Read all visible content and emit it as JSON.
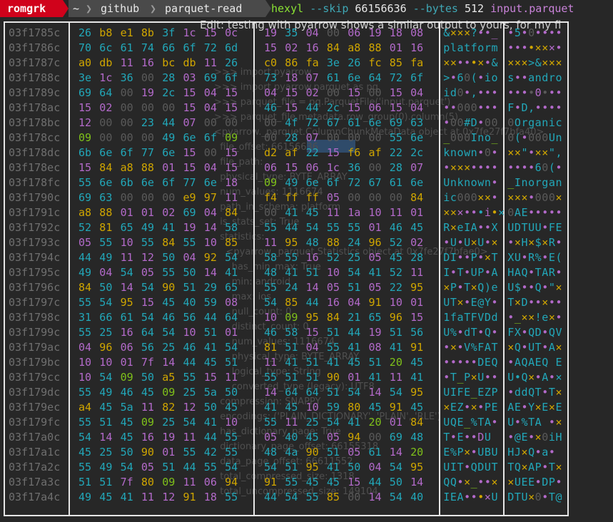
{
  "prompt": {
    "user": "romgrk",
    "path": [
      "~",
      "github",
      "parquet-read"
    ],
    "separator": "❯",
    "command": {
      "program": "hexyl",
      "flag1": "--skip",
      "skip_value": "66156636",
      "flag2": "--bytes",
      "bytes_value": "512",
      "file": "input.parquet"
    }
  },
  "colors": {
    "user_bg": "#d0021b",
    "null": "#5a5a5a",
    "printable": "#22a7b9",
    "whitespace": "#7fc11a",
    "ascii_other": "#d0a600",
    "non_ascii": "#b36aca"
  },
  "background_text": {
    "edit_line": "Edit: testing with pyarrow shows a similar output to yours, for my fi",
    "lines": [
      ">>> import pyarrow",
      ">>> import pyarrow.parquet as pq",
      ">>> parquet_file = pq.ParquetFile('input.parquet')",
      ">>> parquet_file.metadata.row_group(0).column(5)",
      "<pyarrow._parquet.ColumnChunkMetaData object at 0x7fe27f7bfa40>",
      "  file_offset: 66156636",
      "  file_path:",
      "  physical_type: BYTE_ARRAY",
      "  num_values: 1116674",
      "  path_in_schema: platform",
      "  is_stats_set: True",
      "  statistics:",
      "    <pyarrow._parquet.Statistics object at 0x7fe27f7bfae0>",
      "      has_min_max: True",
      "      min: android",
      "      max: ios",
      "      null_count: 0",
      "      distinct_count: 0",
      "      num_values: 1116674",
      "      physical_type: BYTE_ARRAY",
      "      logical_type: String",
      "      converted_type (legacy): UTF8",
      "  compression: SNAPPY",
      "  encodings: ('PLAIN_DICTIONARY', 'PLAIN', 'RLE')",
      "  has_dictionary_page: True",
      "  dictionary_page_offset: 66155318",
      "  data_page_offset: 66611552",
      "  total_compressed_size: 1318",
      "  total_uncompressed_size: 149104"
    ]
  },
  "hexdump": {
    "rows": [
      {
        "addr": "03f1785c",
        "hex1": [
          "26",
          "b8",
          "e1",
          "8b",
          "3f",
          "1c",
          "15",
          "0c"
        ],
        "hex2": [
          "19",
          "35",
          "04",
          "00",
          "06",
          "19",
          "18",
          "08"
        ],
        "ascii1": "&×××?••_",
        "ascii2": "•5•0••••"
      },
      {
        "addr": "03f1786c",
        "hex1": [
          "70",
          "6c",
          "61",
          "74",
          "66",
          "6f",
          "72",
          "6d"
        ],
        "hex2": [
          "15",
          "02",
          "16",
          "84",
          "a8",
          "88",
          "01",
          "16"
        ],
        "ascii1": "platform",
        "ascii2": "••••×××•"
      },
      {
        "addr": "03f1787c",
        "hex1": [
          "a0",
          "db",
          "11",
          "16",
          "bc",
          "db",
          "11",
          "26"
        ],
        "hex2": [
          "c0",
          "86",
          "fa",
          "3e",
          "26",
          "fc",
          "85",
          "fa"
        ],
        "ascii1": "××•••×•&",
        "ascii2": "×××>&×××"
      },
      {
        "addr": "03f1788c",
        "hex1": [
          "3e",
          "1c",
          "36",
          "00",
          "28",
          "03",
          "69",
          "6f"
        ],
        "hex2": [
          "73",
          "18",
          "07",
          "61",
          "6e",
          "64",
          "72",
          "6f"
        ],
        "ascii1": ">•60(•io",
        "ascii2": "s••andro"
      },
      {
        "addr": "03f1789c",
        "hex1": [
          "69",
          "64",
          "00",
          "19",
          "2c",
          "15",
          "04",
          "15"
        ],
        "hex2": [
          "04",
          "15",
          "02",
          "00",
          "15",
          "00",
          "15",
          "04"
        ],
        "ascii1": "id0•,•••",
        "ascii2": "••••0•••"
      },
      {
        "addr": "03f178ac",
        "hex1": [
          "15",
          "02",
          "00",
          "00",
          "00",
          "15",
          "04",
          "15"
        ],
        "hex2": [
          "46",
          "15",
          "44",
          "2c",
          "15",
          "06",
          "15",
          "04"
        ],
        "ascii1": "••000•••",
        "ascii2": "F•D,••••"
      },
      {
        "addr": "03f178bc",
        "hex1": [
          "12",
          "00",
          "00",
          "23",
          "44",
          "07",
          "00",
          "00"
        ],
        "hex2": [
          "00",
          "4f",
          "72",
          "67",
          "61",
          "6e",
          "69",
          "63"
        ],
        "ascii1": "•00#D•00",
        "ascii2": "0Organic"
      },
      {
        "addr": "03f178cc",
        "hex1": [
          "09",
          "00",
          "00",
          "00",
          "49",
          "6e",
          "6f",
          "09"
        ],
        "hex2": [
          "00",
          "28",
          "07",
          "00",
          "00",
          "00",
          "55",
          "6e"
        ],
        "ascii1": "_000Ino_",
        "ascii2": "0(•000Un"
      },
      {
        "addr": "03f178dc",
        "hex1": [
          "6b",
          "6e",
          "6f",
          "77",
          "6e",
          "15",
          "00",
          "15"
        ],
        "hex2": [
          "d2",
          "af",
          "22",
          "15",
          "f6",
          "af",
          "22",
          "2c"
        ],
        "ascii1": "known•0•",
        "ascii2": "××\"•××\","
      },
      {
        "addr": "03f178ec",
        "hex1": [
          "15",
          "84",
          "a8",
          "88",
          "01",
          "15",
          "04",
          "15"
        ],
        "hex2": [
          "06",
          "15",
          "06",
          "1c",
          "36",
          "00",
          "28",
          "07"
        ],
        "ascii1": "•×××••••",
        "ascii2": "••••60(•"
      },
      {
        "addr": "03f178fc",
        "hex1": [
          "55",
          "6e",
          "6b",
          "6e",
          "6f",
          "77",
          "6e",
          "18"
        ],
        "hex2": [
          "09",
          "49",
          "6e",
          "6f",
          "72",
          "67",
          "61",
          "6e"
        ],
        "ascii1": "Unknown•",
        "ascii2": "_Inorgan"
      },
      {
        "addr": "03f1790c",
        "hex1": [
          "69",
          "63",
          "00",
          "00",
          "00",
          "e9",
          "97",
          "11"
        ],
        "hex2": [
          "f4",
          "ff",
          "ff",
          "05",
          "00",
          "00",
          "00",
          "84"
        ],
        "ascii1": "ic000××•",
        "ascii2": "×××•000×"
      },
      {
        "addr": "03f1791c",
        "hex1": [
          "a8",
          "88",
          "01",
          "01",
          "02",
          "69",
          "04",
          "84"
        ],
        "hex2": [
          "00",
          "41",
          "45",
          "11",
          "1a",
          "10",
          "11",
          "01"
        ],
        "ascii1": "×××•••i•×",
        "ascii2": "0AE•••••"
      },
      {
        "addr": "03f1792c",
        "hex1": [
          "52",
          "81",
          "65",
          "49",
          "41",
          "19",
          "14",
          "58"
        ],
        "hex2": [
          "55",
          "44",
          "54",
          "55",
          "55",
          "01",
          "46",
          "45"
        ],
        "ascii1": "R×eIA••X",
        "ascii2": "UDTUU•FE"
      },
      {
        "addr": "03f1793c",
        "hex1": [
          "05",
          "55",
          "10",
          "55",
          "84",
          "55",
          "10",
          "85"
        ],
        "hex2": [
          "11",
          "95",
          "48",
          "88",
          "24",
          "96",
          "52",
          "02"
        ],
        "ascii1": "•U•U×U•×",
        "ascii2": "•×H×$×R•"
      },
      {
        "addr": "03f1794c",
        "hex1": [
          "44",
          "49",
          "11",
          "12",
          "50",
          "04",
          "92",
          "54"
        ],
        "hex2": [
          "58",
          "55",
          "16",
          "52",
          "25",
          "05",
          "45",
          "28"
        ],
        "ascii1": "DI••P•×T",
        "ascii2": "XU•R%•E("
      },
      {
        "addr": "03f1795c",
        "hex1": [
          "49",
          "04",
          "54",
          "05",
          "55",
          "50",
          "14",
          "41"
        ],
        "hex2": [
          "48",
          "41",
          "51",
          "10",
          "54",
          "41",
          "52",
          "11"
        ],
        "ascii1": "I•T•UP•A",
        "ascii2": "HAQ•TAR•"
      },
      {
        "addr": "03f1796c",
        "hex1": [
          "84",
          "50",
          "14",
          "54",
          "90",
          "51",
          "29",
          "65"
        ],
        "hex2": [
          "55",
          "24",
          "14",
          "05",
          "51",
          "05",
          "22",
          "95"
        ],
        "ascii1": "×P•T×Q)e",
        "ascii2": "U$••Q•\"×"
      },
      {
        "addr": "03f1797c",
        "hex1": [
          "55",
          "54",
          "95",
          "15",
          "45",
          "40",
          "59",
          "08"
        ],
        "hex2": [
          "54",
          "85",
          "44",
          "16",
          "04",
          "91",
          "10",
          "01"
        ],
        "ascii1": "UT×•E@Y•",
        "ascii2": "T×D••×••"
      },
      {
        "addr": "03f1798c",
        "hex1": [
          "31",
          "66",
          "61",
          "54",
          "46",
          "56",
          "44",
          "64"
        ],
        "hex2": [
          "10",
          "09",
          "95",
          "84",
          "21",
          "65",
          "96",
          "15"
        ],
        "ascii1": "1faTFVDd",
        "ascii2": "•_××!e×•"
      },
      {
        "addr": "03f1799c",
        "hex1": [
          "55",
          "25",
          "16",
          "64",
          "54",
          "10",
          "51",
          "01"
        ],
        "hex2": [
          "46",
          "58",
          "15",
          "51",
          "44",
          "19",
          "51",
          "56"
        ],
        "ascii1": "U%•dT•Q•",
        "ascii2": "FX•QD•QV"
      },
      {
        "addr": "03f179ac",
        "hex1": [
          "04",
          "96",
          "06",
          "56",
          "25",
          "46",
          "41",
          "54"
        ],
        "hex2": [
          "81",
          "51",
          "04",
          "55",
          "41",
          "08",
          "41",
          "91"
        ],
        "ascii1": "•×•V%FAT",
        "ascii2": "×Q•UT•A×"
      },
      {
        "addr": "03f179bc",
        "hex1": [
          "10",
          "10",
          "01",
          "7f",
          "14",
          "44",
          "45",
          "51"
        ],
        "hex2": [
          "11",
          "41",
          "51",
          "41",
          "45",
          "51",
          "20",
          "45"
        ],
        "ascii1": "•••••DEQ",
        "ascii2": "•AQAEQ E"
      },
      {
        "addr": "03f179cc",
        "hex1": [
          "10",
          "54",
          "09",
          "50",
          "a5",
          "55",
          "15",
          "11"
        ],
        "hex2": [
          "55",
          "51",
          "51",
          "90",
          "01",
          "41",
          "11",
          "41"
        ],
        "ascii1": "•T_P×U••",
        "ascii2": "U•Q×•A•×"
      },
      {
        "addr": "03f179dc",
        "hex1": [
          "55",
          "49",
          "46",
          "45",
          "09",
          "25",
          "5a",
          "50"
        ],
        "hex2": [
          "14",
          "64",
          "64",
          "51",
          "54",
          "14",
          "54",
          "95"
        ],
        "ascii1": "UIFE_EZP",
        "ascii2": "•ddQT•T×"
      },
      {
        "addr": "03f179ec",
        "hex1": [
          "a4",
          "45",
          "5a",
          "11",
          "82",
          "12",
          "50",
          "45"
        ],
        "hex2": [
          "41",
          "45",
          "10",
          "59",
          "80",
          "45",
          "91",
          "45"
        ],
        "ascii1": "×EZ•×•PE",
        "ascii2": "AE•Y×E×E"
      },
      {
        "addr": "03f179fc",
        "hex1": [
          "55",
          "51",
          "45",
          "09",
          "25",
          "54",
          "41",
          "10"
        ],
        "hex2": [
          "55",
          "11",
          "25",
          "54",
          "41",
          "20",
          "01",
          "84"
        ],
        "ascii1": "UQE_%TA•",
        "ascii2": "U•%TA •×"
      },
      {
        "addr": "03f17a0c",
        "hex1": [
          "54",
          "14",
          "45",
          "16",
          "19",
          "11",
          "44",
          "55"
        ],
        "hex2": [
          "05",
          "40",
          "45",
          "05",
          "94",
          "00",
          "69",
          "48"
        ],
        "ascii1": "T•E••DU",
        "ascii2": "•@E•×0iH"
      },
      {
        "addr": "03f17a1c",
        "hex1": [
          "45",
          "25",
          "50",
          "90",
          "01",
          "55",
          "42",
          "55"
        ],
        "hex2": [
          "48",
          "4a",
          "90",
          "51",
          "05",
          "61",
          "14",
          "20"
        ],
        "ascii1": "E%P×•UBU",
        "ascii2": "HJ×Q•a• "
      },
      {
        "addr": "03f17a2c",
        "hex1": [
          "55",
          "49",
          "54",
          "05",
          "51",
          "44",
          "55",
          "54"
        ],
        "hex2": [
          "54",
          "51",
          "95",
          "41",
          "50",
          "04",
          "54",
          "95"
        ],
        "ascii1": "UIT•QDUT",
        "ascii2": "TQ×AP•T×"
      },
      {
        "addr": "03f17a3c",
        "hex1": [
          "51",
          "51",
          "7f",
          "80",
          "09",
          "11",
          "06",
          "94"
        ],
        "hex2": [
          "91",
          "55",
          "45",
          "45",
          "15",
          "44",
          "50",
          "14"
        ],
        "ascii1": "QQ•×_••×",
        "ascii2": "×UEE•DP•"
      },
      {
        "addr": "03f17a4c",
        "hex1": [
          "49",
          "45",
          "41",
          "11",
          "12",
          "91",
          "18",
          "55"
        ],
        "hex2": [
          "44",
          "54",
          "55",
          "85",
          "00",
          "14",
          "54",
          "40"
        ],
        "ascii1": "IEA•••×U",
        "ascii2": "DTU×0•T@"
      }
    ]
  }
}
